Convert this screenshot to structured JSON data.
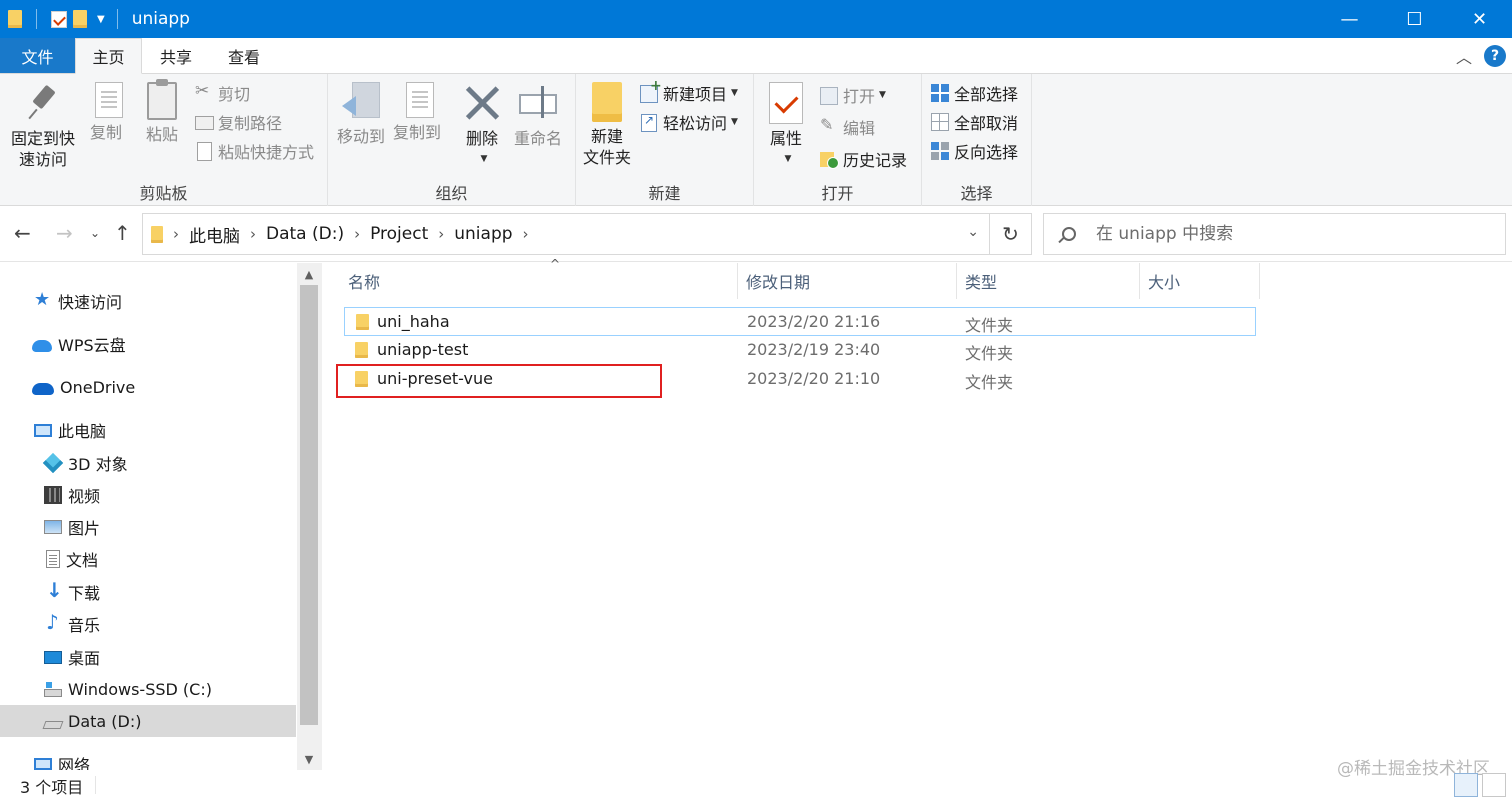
{
  "window": {
    "title": "uniapp",
    "controls": {
      "minimize": "—",
      "maximize": "☐",
      "close": "✕"
    }
  },
  "ribbon_tabs": [
    {
      "label": "文件"
    },
    {
      "label": "主页"
    },
    {
      "label": "共享"
    },
    {
      "label": "查看"
    }
  ],
  "ribbon": {
    "clipboard": {
      "label": "剪贴板",
      "pin": "固定到快\n速访问",
      "pin_line1": "固定到快",
      "pin_line2": "速访问",
      "copy": "复制",
      "paste": "粘贴",
      "cut": "剪切",
      "copy_path": "复制路径",
      "paste_shortcut": "粘贴快捷方式"
    },
    "organize": {
      "label": "组织",
      "move_to": "移动到",
      "copy_to": "复制到",
      "delete": "删除",
      "rename": "重命名"
    },
    "new": {
      "label": "新建",
      "new_folder_line1": "新建",
      "new_folder_line2": "文件夹",
      "new_item": "新建项目",
      "easy_access": "轻松访问"
    },
    "open": {
      "label": "打开",
      "properties": "属性",
      "open": "打开",
      "edit": "编辑",
      "history": "历史记录"
    },
    "select": {
      "label": "选择",
      "select_all": "全部选择",
      "select_none": "全部取消",
      "invert": "反向选择"
    }
  },
  "address": {
    "breadcrumbs": [
      "此电脑",
      "Data (D:)",
      "Project",
      "uniapp"
    ]
  },
  "search": {
    "placeholder": "在 uniapp 中搜索"
  },
  "nav_pane": [
    {
      "label": "快速访问",
      "icon": "star-icon"
    },
    {
      "label": "WPS云盘",
      "icon": "cloud-icon"
    },
    {
      "label": "OneDrive",
      "icon": "onedrive-icon"
    },
    {
      "label": "此电脑",
      "icon": "computer-icon"
    },
    {
      "label": "3D 对象",
      "icon": "cube-icon"
    },
    {
      "label": "视频",
      "icon": "video-icon"
    },
    {
      "label": "图片",
      "icon": "picture-icon"
    },
    {
      "label": "文档",
      "icon": "document-icon"
    },
    {
      "label": "下载",
      "icon": "download-icon"
    },
    {
      "label": "音乐",
      "icon": "music-icon"
    },
    {
      "label": "桌面",
      "icon": "desktop-icon"
    },
    {
      "label": "Windows-SSD (C:)",
      "icon": "drive-c-icon"
    },
    {
      "label": "Data (D:)",
      "icon": "drive-d-icon",
      "selected": true
    },
    {
      "label": "网络",
      "icon": "network-icon"
    }
  ],
  "file_list": {
    "columns": [
      "名称",
      "修改日期",
      "类型",
      "大小"
    ],
    "rows": [
      {
        "name": "uni_haha",
        "modified": "2023/2/20 21:16",
        "type": "文件夹",
        "size": ""
      },
      {
        "name": "uniapp-test",
        "modified": "2023/2/19 23:40",
        "type": "文件夹",
        "size": ""
      },
      {
        "name": "uni-preset-vue",
        "modified": "2023/2/20 21:10",
        "type": "文件夹",
        "size": ""
      }
    ]
  },
  "status": {
    "count": "3 个项目",
    "watermark": "@稀土掘金技术社区"
  },
  "colors": {
    "titlebar": "#0078d7",
    "file_tab": "#1979ca",
    "highlight": "#e02020",
    "selected_nav": "#d9d9d9"
  }
}
